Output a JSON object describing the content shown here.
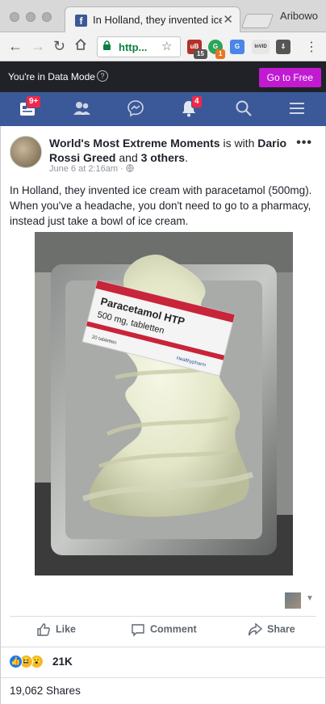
{
  "browser": {
    "tab_title": "In Holland, they invented ice",
    "tab_close": "✕",
    "profile_name": "Aribowo",
    "url_text": "http...",
    "favicon": "f",
    "extensions": [
      {
        "name": "ublock",
        "badge": "15",
        "color": "#b4312a"
      },
      {
        "name": "ghostery",
        "badge": "1",
        "color": "#2aa55a"
      },
      {
        "name": "translate",
        "badge": "",
        "color": "#4a86e8"
      },
      {
        "name": "invid",
        "badge": "",
        "label": "InVID",
        "color": "#e7e7e7"
      },
      {
        "name": "download",
        "badge": "",
        "color": "#555555"
      }
    ]
  },
  "data_mode": {
    "text": "You're in Data Mode",
    "help": "?",
    "button": "Go to Free"
  },
  "fb_nav": {
    "news_badge": "9+",
    "notif_badge": "4"
  },
  "post": {
    "page_name": "World's Most Extreme Moments",
    "is_with": "is with",
    "friend": "Dario Rossi Greed",
    "and_text": "and",
    "others": "3 others",
    "period": ".",
    "time": "June 6 at 2:16am",
    "time_sep": "·",
    "more": "•••",
    "text": "In Holland, they invented ice cream with paracetamol (500mg). When you've a headache, you don't need to go to a pharmacy, instead just take a bowl of ice cream.",
    "box_line1": "Paracetamol HTP",
    "box_line2": "500 mg, tabletten",
    "box_count": "20 tabletten",
    "box_brand": "Healthypharm",
    "actions": {
      "like": "Like",
      "comment": "Comment",
      "share": "Share"
    },
    "reaction_count": "21K",
    "shares": "19,062 Shares"
  },
  "colors": {
    "fb_blue": "#3b5998",
    "badge_red": "#f02849",
    "go_free": "#c11ad1",
    "secure_green": "#0b8043"
  }
}
